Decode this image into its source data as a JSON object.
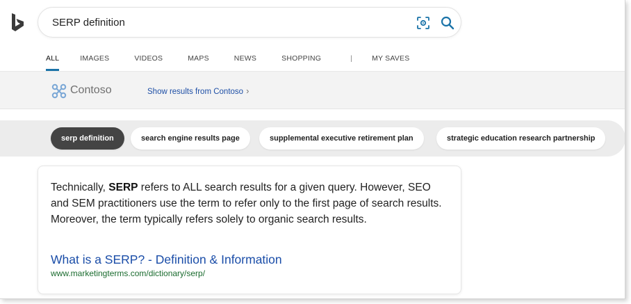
{
  "search": {
    "query": "SERP definition",
    "visual_search_icon": "visual-search-icon",
    "search_icon": "search-icon"
  },
  "logo": {
    "icon": "bing-logo-icon",
    "color": "#3a3a3a"
  },
  "tabs": [
    {
      "label": "ALL",
      "active": true
    },
    {
      "label": "IMAGES"
    },
    {
      "label": "VIDEOS"
    },
    {
      "label": "MAPS"
    },
    {
      "label": "NEWS"
    },
    {
      "label": "SHOPPING"
    },
    {
      "label": "|"
    },
    {
      "label": "MY SAVES"
    }
  ],
  "contoso": {
    "name": "Contoso",
    "link": "Show results from Contoso",
    "chevron": "›"
  },
  "chips": [
    {
      "label": "serp definition",
      "active": true
    },
    {
      "label": "search engine results page"
    },
    {
      "label": "supplemental executive retirement plan"
    },
    {
      "label": "strategic education research partnership"
    }
  ],
  "answer": {
    "text_before": "Technically, ",
    "text_bold": "SERP",
    "text_after": " refers to ALL search results for a given query. However, SEO and SEM practitioners use the term to refer only to the first page of search results. Moreover, the term typically refers solely to organic search results.",
    "title": "What is a SERP? - Definition & Information",
    "url": "www.marketingterms.com/dictionary/serp/"
  },
  "colors": {
    "accent": "#1a73a8",
    "link": "#1a4da8",
    "url_green": "#1a6b2e",
    "chip_active": "#444444"
  }
}
